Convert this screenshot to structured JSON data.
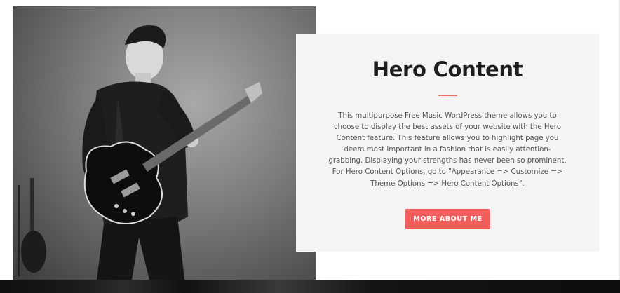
{
  "hero": {
    "title": "Hero Content",
    "description": "This multipurpose Free Music WordPress theme allows you to choose to display the best assets of your website with the Hero Content feature. This feature allows you to highlight page you deem most important in a fashion that is easily attention-grabbing. Displaying your strengths has never been so prominent. For Hero Content Options, go to \"Appearance => Customize => Theme Options => Hero Content Options\".",
    "button_label": "MORE ABOUT ME",
    "accent_color": "#f05f5c",
    "image_alt": "guitarist-photo"
  }
}
